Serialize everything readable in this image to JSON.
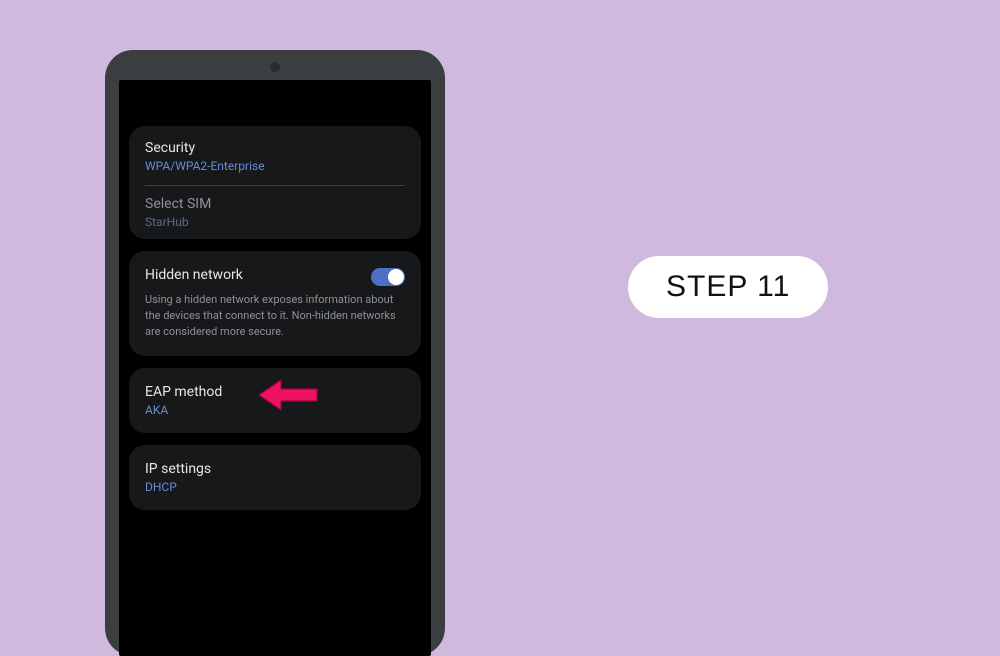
{
  "step_badge": "STEP 11",
  "settings": {
    "security": {
      "label": "Security",
      "value": "WPA/WPA2-Enterprise"
    },
    "select_sim": {
      "label": "Select SIM",
      "value": "StarHub"
    },
    "hidden_network": {
      "label": "Hidden network",
      "toggle_on": true,
      "description": "Using a hidden network exposes information about the devices that connect to it. Non-hidden networks are considered more secure."
    },
    "eap_method": {
      "label": "EAP method",
      "value": "AKA"
    },
    "ip_settings": {
      "label": "IP settings",
      "value": "DHCP"
    }
  },
  "colors": {
    "page_bg": "#cfbadd",
    "device_frame": "#3a3e41",
    "screen_bg": "#000000",
    "card_bg": "#17181a",
    "link_blue": "#6a8bd6",
    "arrow_pink": "#ec1360"
  }
}
